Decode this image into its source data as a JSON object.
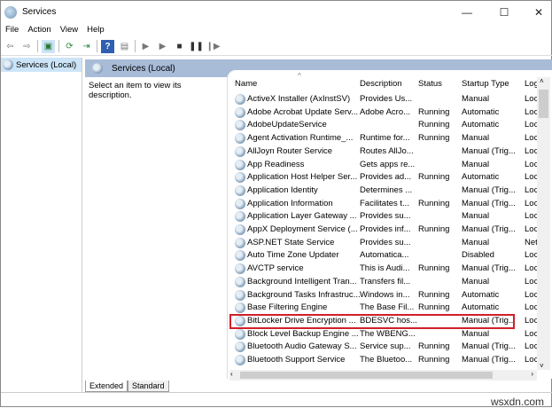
{
  "window": {
    "title": "Services",
    "minimize": "—",
    "maximize": "☐",
    "close": "✕"
  },
  "menu": [
    "File",
    "Action",
    "View",
    "Help"
  ],
  "tree": {
    "root": "Services (Local)"
  },
  "panel": {
    "title": "Services (Local)",
    "description_hint": "Select an item to view its description."
  },
  "columns": {
    "name": "Name",
    "description": "Description",
    "status": "Status",
    "startup": "Startup Type",
    "logon": "Log"
  },
  "rows": [
    {
      "name": "ActiveX Installer (AxInstSV)",
      "description": "Provides Us...",
      "status": "",
      "startup": "Manual",
      "logon": "Loc:"
    },
    {
      "name": "Adobe Acrobat Update Serv...",
      "description": "Adobe Acro...",
      "status": "Running",
      "startup": "Automatic",
      "logon": "Loc:"
    },
    {
      "name": "AdobeUpdateService",
      "description": "",
      "status": "Running",
      "startup": "Automatic",
      "logon": "Loc:"
    },
    {
      "name": "Agent Activation Runtime_...",
      "description": "Runtime for...",
      "status": "Running",
      "startup": "Manual",
      "logon": "Loc:"
    },
    {
      "name": "AllJoyn Router Service",
      "description": "Routes AllJo...",
      "status": "",
      "startup": "Manual (Trig...",
      "logon": "Loc:"
    },
    {
      "name": "App Readiness",
      "description": "Gets apps re...",
      "status": "",
      "startup": "Manual",
      "logon": "Loc:"
    },
    {
      "name": "Application Host Helper Ser...",
      "description": "Provides ad...",
      "status": "Running",
      "startup": "Automatic",
      "logon": "Loc:"
    },
    {
      "name": "Application Identity",
      "description": "Determines ...",
      "status": "",
      "startup": "Manual (Trig...",
      "logon": "Loc:"
    },
    {
      "name": "Application Information",
      "description": "Facilitates t...",
      "status": "Running",
      "startup": "Manual (Trig...",
      "logon": "Loc:"
    },
    {
      "name": "Application Layer Gateway ...",
      "description": "Provides su...",
      "status": "",
      "startup": "Manual",
      "logon": "Loc:"
    },
    {
      "name": "AppX Deployment Service (...",
      "description": "Provides inf...",
      "status": "Running",
      "startup": "Manual (Trig...",
      "logon": "Loc:"
    },
    {
      "name": "ASP.NET State Service",
      "description": "Provides su...",
      "status": "",
      "startup": "Manual",
      "logon": "Netv"
    },
    {
      "name": "Auto Time Zone Updater",
      "description": "Automatica...",
      "status": "",
      "startup": "Disabled",
      "logon": "Loc:"
    },
    {
      "name": "AVCTP service",
      "description": "This is Audi...",
      "status": "Running",
      "startup": "Manual (Trig...",
      "logon": "Loc:"
    },
    {
      "name": "Background Intelligent Tran...",
      "description": "Transfers fil...",
      "status": "",
      "startup": "Manual",
      "logon": "Loc:"
    },
    {
      "name": "Background Tasks Infrastruc...",
      "description": "Windows in...",
      "status": "Running",
      "startup": "Automatic",
      "logon": "Loc:"
    },
    {
      "name": "Base Filtering Engine",
      "description": "The Base Fil...",
      "status": "Running",
      "startup": "Automatic",
      "logon": "Loc:"
    },
    {
      "name": "BitLocker Drive Encryption ...",
      "description": "BDESVC hos...",
      "status": "",
      "startup": "Manual (Trig...",
      "logon": "Loc:"
    },
    {
      "name": "Block Level Backup Engine ...",
      "description": "The WBENG...",
      "status": "",
      "startup": "Manual",
      "logon": "Loc:"
    },
    {
      "name": "Bluetooth Audio Gateway S...",
      "description": "Service sup...",
      "status": "Running",
      "startup": "Manual (Trig...",
      "logon": "Loc:"
    },
    {
      "name": "Bluetooth Support Service",
      "description": "The Bluetoo...",
      "status": "Running",
      "startup": "Manual (Trig...",
      "logon": "Loc:"
    }
  ],
  "highlight_color": "#d0202a",
  "tabs": [
    "Extended",
    "Standard"
  ],
  "watermark": "wsxdn.com"
}
